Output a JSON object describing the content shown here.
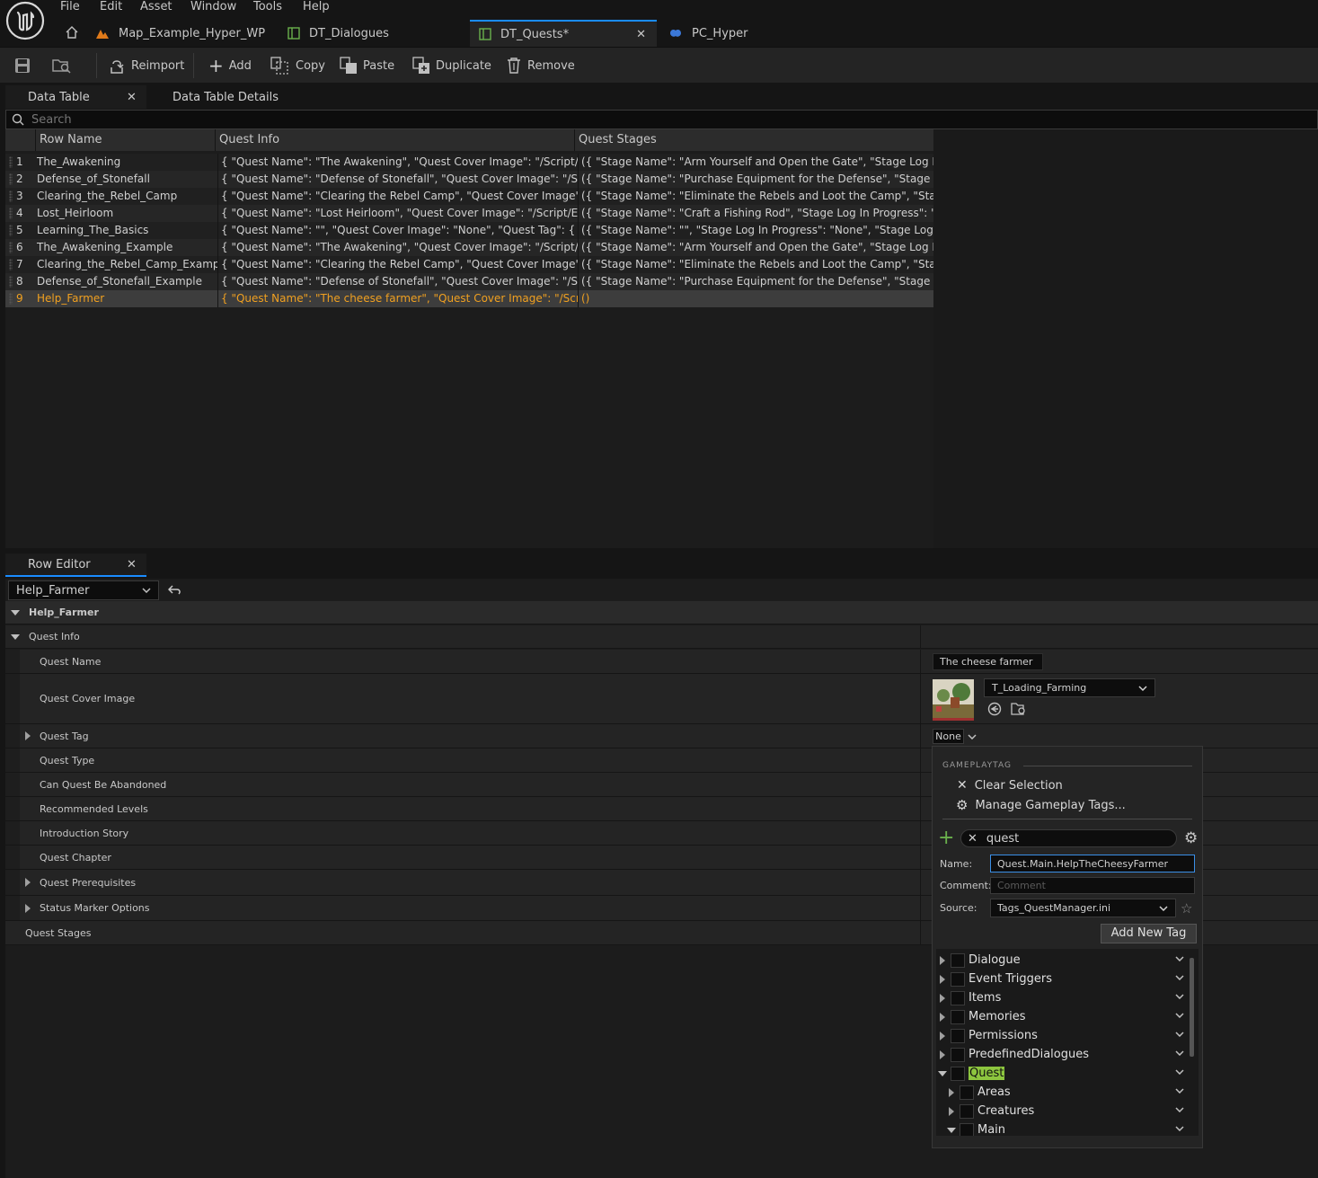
{
  "menu": [
    "File",
    "Edit",
    "Asset",
    "Window",
    "Tools",
    "Help"
  ],
  "doc_tabs": [
    {
      "label": "Map_Example_Hyper_WP"
    },
    {
      "label": "DT_Dialogues"
    },
    {
      "label": "DT_Quests*"
    },
    {
      "label": "PC_Hyper"
    }
  ],
  "toolbar": {
    "reimport": "Reimport",
    "add": "Add",
    "copy": "Copy",
    "paste": "Paste",
    "duplicate": "Duplicate",
    "remove": "Remove"
  },
  "panels": {
    "data_table_tab": "Data Table",
    "details_tab": "Data Table Details",
    "row_editor_tab": "Row Editor"
  },
  "search": {
    "placeholder": "Search"
  },
  "table": {
    "headers": [
      "Row Name",
      "Quest Info",
      "Quest Stages"
    ],
    "rows": [
      {
        "num": "1",
        "name": "The_Awakening",
        "info": "{ \"Quest Name\": \"The Awakening\", \"Quest Cover Image\": \"/Script/Engine.Te",
        "stages": "({ \"Stage Name\": \"Arm Yourself and Open the Gate\", \"Stage Log In Progres"
      },
      {
        "num": "2",
        "name": "Defense_of_Stonefall",
        "info": "{ \"Quest Name\": \"Defense of Stonefall\", \"Quest Cover Image\": \"/Script/Engi",
        "stages": "({ \"Stage Name\": \"Purchase Equipment for the Defense\", \"Stage Log In Pro"
      },
      {
        "num": "3",
        "name": "Clearing_the_Rebel_Camp",
        "info": "{ \"Quest Name\": \"Clearing the Rebel Camp\", \"Quest Cover Image\": \"/Script/",
        "stages": "({ \"Stage Name\": \"Eliminate the Rebels and Loot the Camp\", \"Stage Log In"
      },
      {
        "num": "4",
        "name": "Lost_Heirloom",
        "info": "{ \"Quest Name\": \"Lost Heirloom\", \"Quest Cover Image\": \"/Script/Engine.Tex",
        "stages": "({ \"Stage Name\": \"Craft a Fishing Rod\", \"Stage Log In Progress\": \"The villa"
      },
      {
        "num": "5",
        "name": "Learning_The_Basics",
        "info": "{ \"Quest Name\": \"\", \"Quest Cover Image\": \"None\", \"Quest Tag\": { \"TagName\"",
        "stages": "({ \"Stage Name\": \"\", \"Stage Log In Progress\": \"None\", \"Stage Log Complete"
      },
      {
        "num": "6",
        "name": "The_Awakening_Example",
        "info": "{ \"Quest Name\": \"The Awakening\", \"Quest Cover Image\": \"/Script/Engine.Te",
        "stages": "({ \"Stage Name\": \"Arm Yourself and Open the Gate\", \"Stage Log In Progres"
      },
      {
        "num": "7",
        "name": "Clearing_the_Rebel_Camp_Examp",
        "info": "{ \"Quest Name\": \"Clearing the Rebel Camp\", \"Quest Cover Image\": \"/Script/",
        "stages": "({ \"Stage Name\": \"Eliminate the Rebels and Loot the Camp\", \"Stage Log In"
      },
      {
        "num": "8",
        "name": "Defense_of_Stonefall_Example",
        "info": "{ \"Quest Name\": \"Defense of Stonefall\", \"Quest Cover Image\": \"/Script/Engi",
        "stages": "({ \"Stage Name\": \"Purchase Equipment for the Defense\", \"Stage Log In Pro"
      },
      {
        "num": "9",
        "name": "Help_Farmer",
        "info": "{ \"Quest Name\": \"The cheese farmer\", \"Quest Cover Image\": \"/Script/Engine",
        "stages": "()"
      }
    ]
  },
  "row_editor": {
    "selected_row": "Help_Farmer",
    "struct_name": "Help_Farmer",
    "quest_info_label": "Quest Info",
    "properties": {
      "quest_name": "Quest Name",
      "quest_cover_image": "Quest Cover Image",
      "quest_tag": "Quest Tag",
      "quest_type": "Quest Type",
      "can_abandon": "Can Quest Be Abandoned",
      "recommended_levels": "Recommended Levels",
      "introduction_story": "Introduction Story",
      "quest_chapter": "Quest Chapter",
      "quest_prerequisites": "Quest Prerequisites",
      "status_marker": "Status Marker Options",
      "quest_stages": "Quest Stages"
    },
    "values": {
      "quest_name": "The cheese farmer",
      "cover_asset": "T_Loading_Farming",
      "quest_tag": "None"
    }
  },
  "tag_popup": {
    "section_label": "GAMEPLAYTAG",
    "clear_selection": "Clear Selection",
    "manage_tags": "Manage Gameplay Tags...",
    "search_value": "quest",
    "name_label": "Name:",
    "name_value": "Quest.Main.HelpTheCheesyFarmer",
    "comment_label": "Comment:",
    "comment_placeholder": "Comment",
    "source_label": "Source:",
    "source_value": "Tags_QuestManager.ini",
    "add_new_tag": "Add New Tag",
    "tree": [
      {
        "label": "Dialogue",
        "level": 0,
        "expanded": false
      },
      {
        "label": "Event Triggers",
        "level": 0,
        "expanded": false
      },
      {
        "label": "Items",
        "level": 0,
        "expanded": false
      },
      {
        "label": "Memories",
        "level": 0,
        "expanded": false
      },
      {
        "label": "Permissions",
        "level": 0,
        "expanded": false
      },
      {
        "label": "PredefinedDialogues",
        "level": 0,
        "expanded": false
      },
      {
        "label": "Quest",
        "level": 0,
        "expanded": true,
        "highlight": true
      },
      {
        "label": "Areas",
        "level": 1,
        "expanded": false
      },
      {
        "label": "Creatures",
        "level": 1,
        "expanded": false
      },
      {
        "label": "Main",
        "level": 1,
        "expanded": true
      }
    ]
  },
  "colors": {
    "accent_blue": "#1a8cff",
    "selected_row_text": "#f0a020",
    "tag_highlight": "#8dc63f",
    "add_green": "#6ab04c"
  }
}
